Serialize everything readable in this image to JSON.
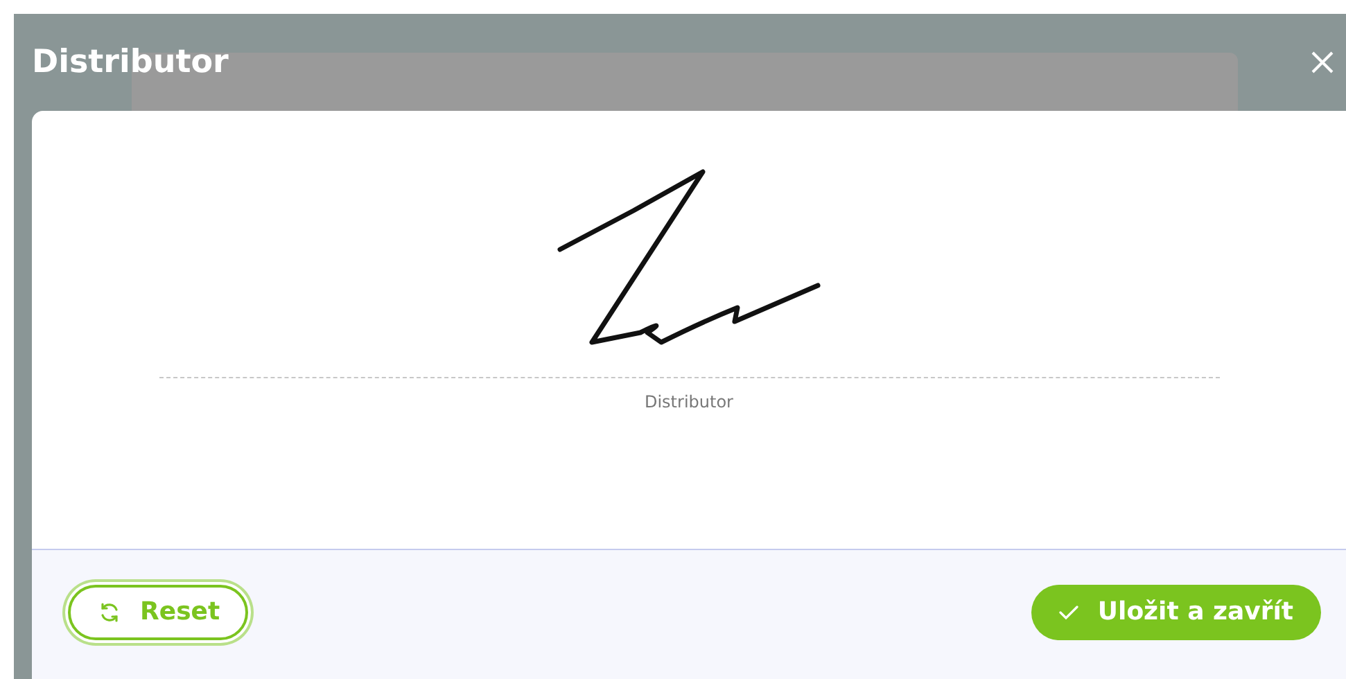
{
  "dialog": {
    "title": "Distributor"
  },
  "signature": {
    "label": "Distributor"
  },
  "buttons": [
    {
      "kind": "outline",
      "label": "Reset",
      "focused": true
    },
    {
      "kind": "primary",
      "label": "Uložit a zavřít",
      "focused": false
    }
  ]
}
